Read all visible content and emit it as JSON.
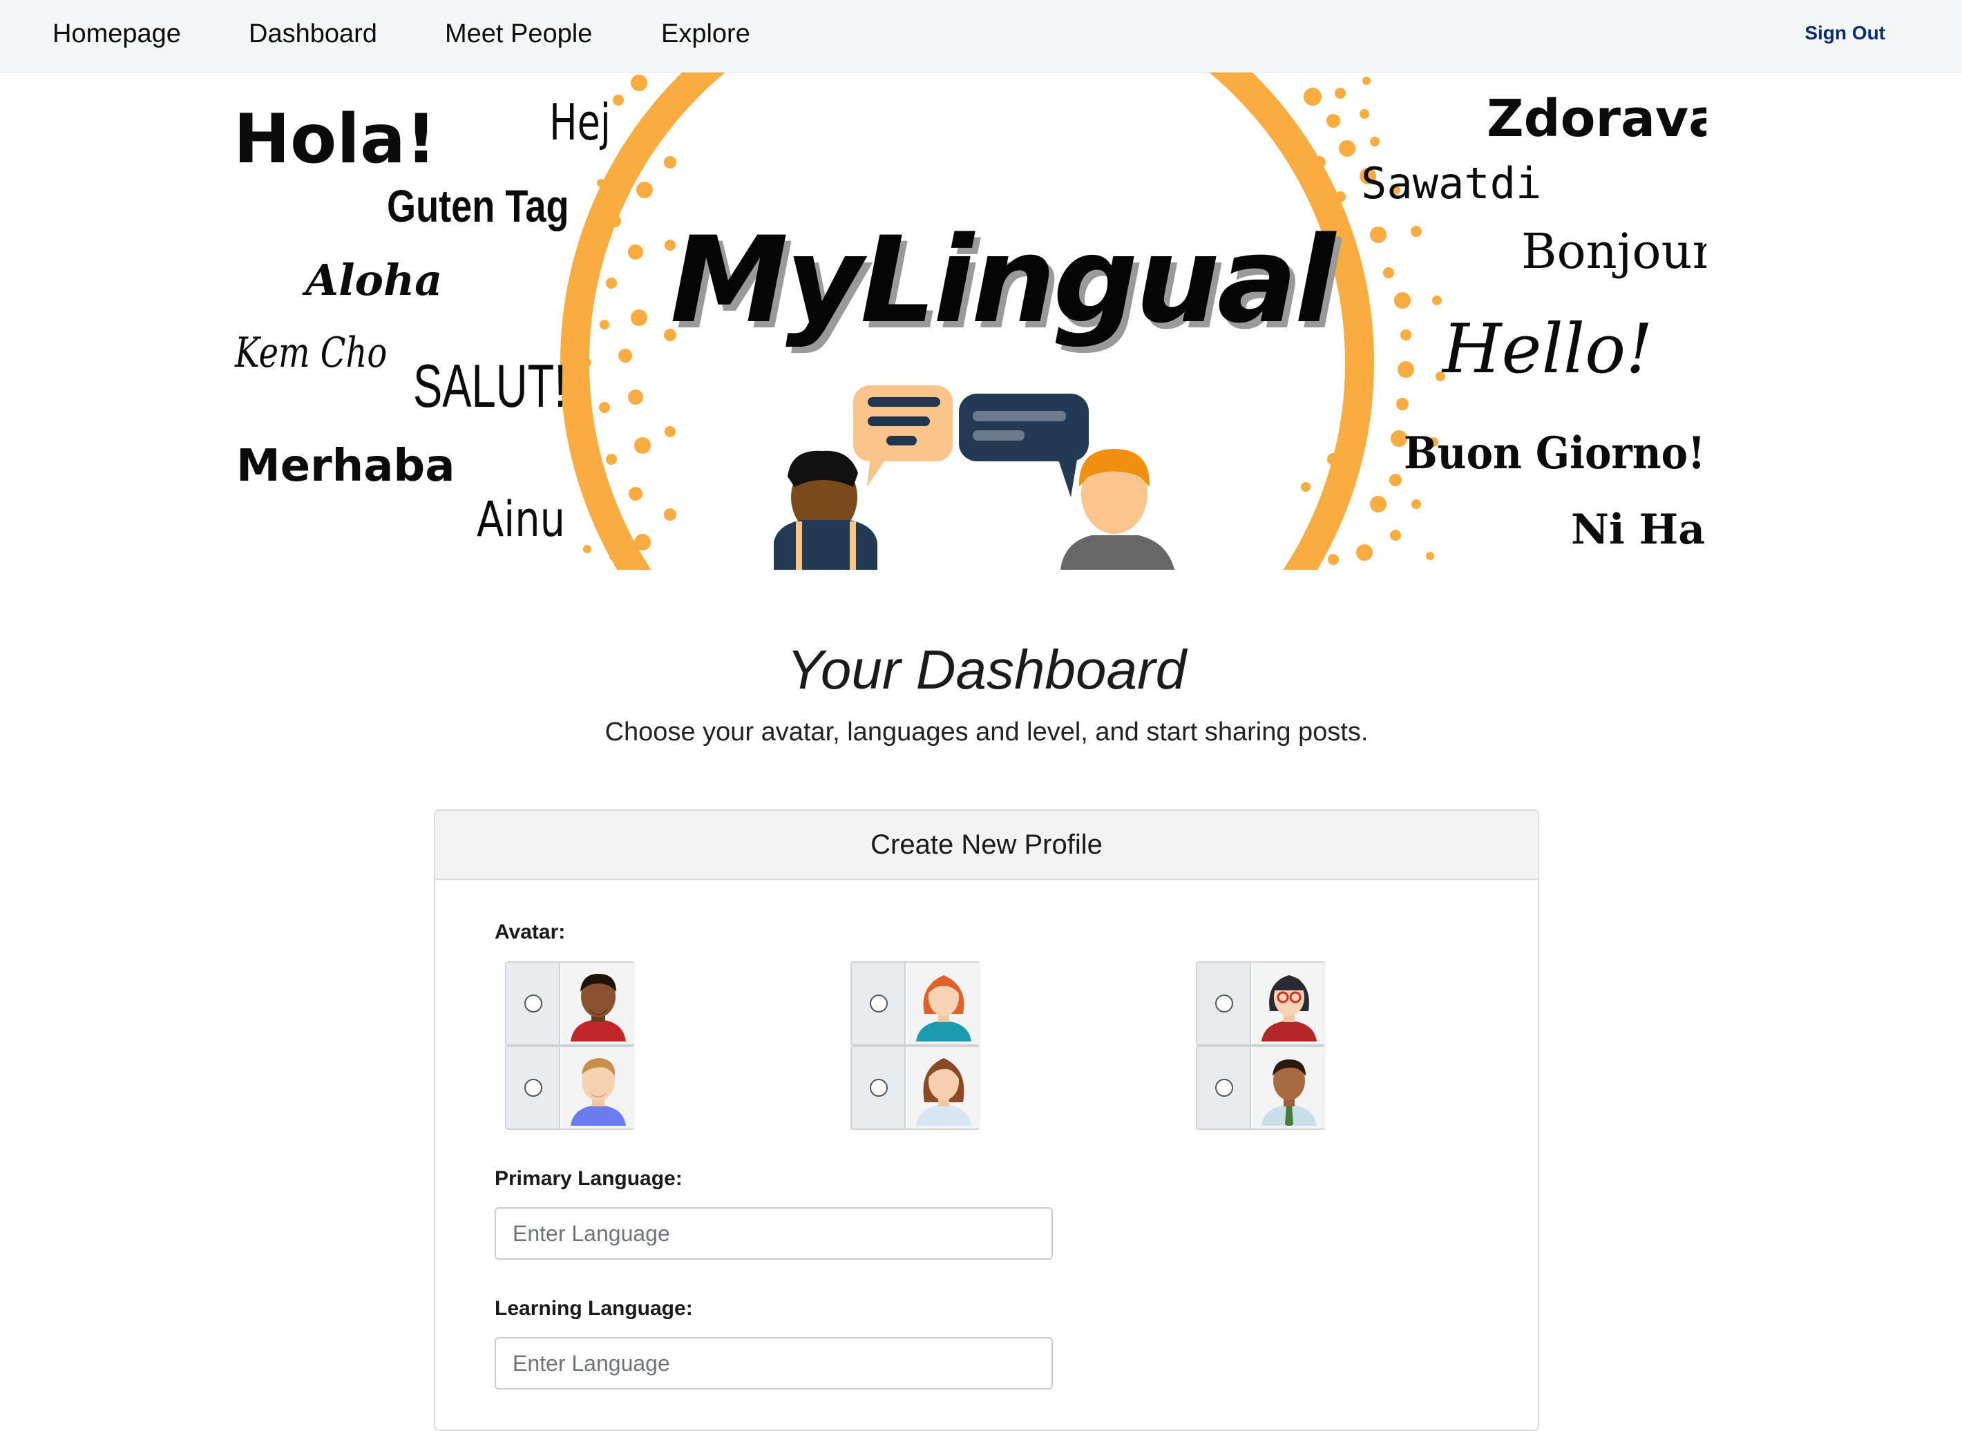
{
  "nav": {
    "links": [
      "Homepage",
      "Dashboard",
      "Meet People",
      "Explore"
    ],
    "sign_out": "Sign Out"
  },
  "banner": {
    "logo": "MyLingual",
    "greetings_left": [
      "Hola!",
      "Hej",
      "Guten Tag",
      "Aloha",
      "Kem Cho",
      "SALUT!",
      "Merhaba",
      "Ainu"
    ],
    "greetings_right": [
      "Zdorava",
      "Sawatdi",
      "Bonjour",
      "Hello!",
      "Buon Giorno!",
      "Ni Hao"
    ],
    "accent_color": "#fbac41"
  },
  "dashboard": {
    "title": "Your Dashboard",
    "subtitle": "Choose your avatar, languages and level, and start sharing posts."
  },
  "form": {
    "header": "Create New Profile",
    "avatar_label": "Avatar:",
    "primary_label": "Primary Language:",
    "primary_placeholder": "Enter Language",
    "learning_label": "Learning Language:",
    "learning_placeholder": "Enter Language",
    "avatars": [
      "man-dark-hair-red-shirt",
      "woman-red-hair-teal-shirt",
      "woman-glasses-red-shirt",
      "man-blond-blue-shirt",
      "woman-brown-hair-white-shirt",
      "man-dark-hair-shirt-tie"
    ]
  }
}
